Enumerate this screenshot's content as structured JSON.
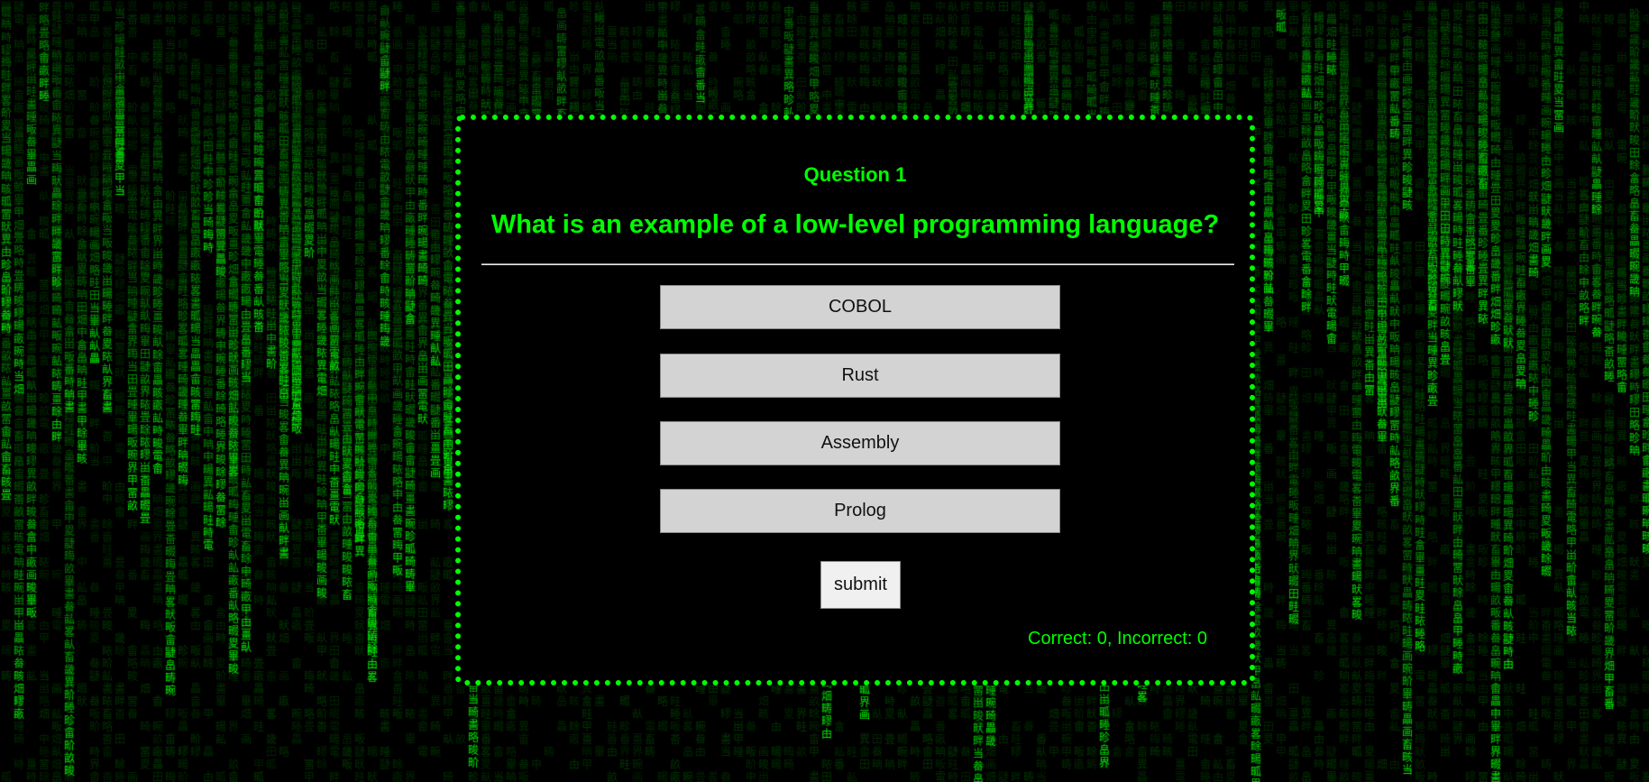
{
  "theme": {
    "accent": "#00ff00",
    "background": "#000000",
    "option_bg": "#d3d3d3",
    "submit_bg": "#f0f0f0"
  },
  "quiz": {
    "question_number": "Question 1",
    "question_text": "What is an example of a low-level programming language?",
    "options": [
      "COBOL",
      "Rust",
      "Assembly",
      "Prolog"
    ],
    "submit_label": "submit",
    "score_text": "Correct: 0, Incorrect: 0"
  }
}
